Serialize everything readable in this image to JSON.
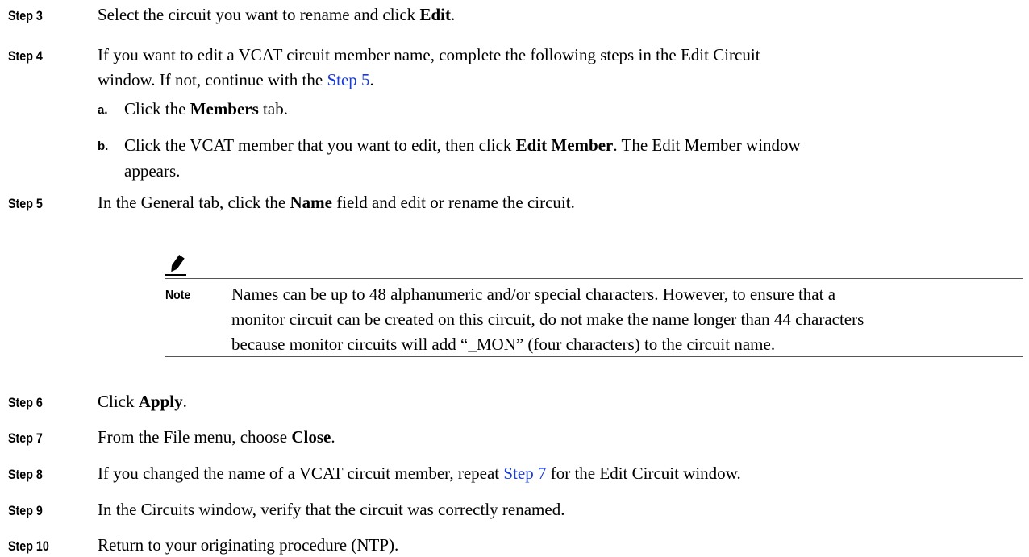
{
  "steps": [
    {
      "label": "Step 3",
      "pre": "Select the circuit you want to rename and click ",
      "bold": "Edit",
      "post": "."
    },
    {
      "label": "Step 4",
      "line1": "If you want to edit a VCAT circuit member name, complete the following steps in the Edit Circuit",
      "line2_pre": "window. If not, continue with the ",
      "link": "Step 5",
      "line2_post": ".",
      "substeps": [
        {
          "label": "a.",
          "pre": "Click the ",
          "bold": "Members",
          "post": " tab."
        },
        {
          "label": "b.",
          "pre": "Click the VCAT member that you want to edit, then click ",
          "bold": "Edit Member",
          "post": ". The Edit Member window",
          "line2": "appears."
        }
      ]
    },
    {
      "label": "Step 5",
      "pre": "In the General tab, click the ",
      "bold": "Name",
      "post": " field and edit or rename the circuit."
    },
    {
      "label": "Step 6",
      "pre": "Click ",
      "bold": "Apply",
      "post": "."
    },
    {
      "label": "Step 7",
      "pre": "From the File menu, choose ",
      "bold": "Close",
      "post": "."
    },
    {
      "label": "Step 8",
      "pre": "If you changed the name of a VCAT circuit member, repeat ",
      "link": "Step 7",
      "post": " for the Edit Circuit window."
    },
    {
      "label": "Step 9",
      "text": "In the Circuits window, verify that the circuit was correctly renamed."
    },
    {
      "label": "Step 10",
      "text": "Return to your originating procedure (NTP)."
    }
  ],
  "note": {
    "label": "Note",
    "lines": [
      "Names can be up to 48 alphanumeric and/or special characters. However, to ensure that a",
      "monitor circuit can be created on this circuit, do not make the name longer than 44 characters",
      "because monitor circuits will add “_MON” (four characters) to the circuit name."
    ],
    "icon": "pencil-icon"
  }
}
